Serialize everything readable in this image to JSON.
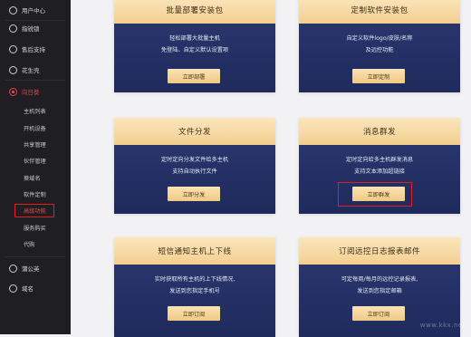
{
  "sidebar": {
    "items": [
      {
        "label": "用户中心"
      },
      {
        "label": "指锐锁"
      },
      {
        "label": "售后支持"
      },
      {
        "label": "花生壳"
      },
      {
        "label": "向日葵"
      }
    ],
    "subitems": [
      {
        "label": "主机列表"
      },
      {
        "label": "开机设备"
      },
      {
        "label": "共享管理"
      },
      {
        "label": "伙伴管理"
      },
      {
        "label": "葵域名"
      },
      {
        "label": "软件定制"
      },
      {
        "label": "高级功能"
      },
      {
        "label": "服务购买"
      },
      {
        "label": "代购"
      }
    ],
    "bottom": [
      {
        "label": "蒲公英"
      },
      {
        "label": "域名"
      }
    ]
  },
  "cards": [
    {
      "title": "批量部署安装包",
      "lines": [
        "轻松部署大批量主机",
        "免登陆、自定义默认设置项"
      ],
      "button": "立即部署"
    },
    {
      "title": "定制软件安装包",
      "lines": [
        "自定义软件logo/皮肤/名称",
        "及远控功能"
      ],
      "button": "立即定制"
    },
    {
      "title": "文件分发",
      "lines": [
        "定时定向分发文件给多主机",
        "支持自动执行文件"
      ],
      "button": "立即分发"
    },
    {
      "title": "消息群发",
      "lines": [
        "定时定向给多主机群发消息",
        "支持文本添加超链接"
      ],
      "button": "立即群发"
    },
    {
      "title": "短信通知主机上下线",
      "lines": [
        "实时获取所有主机的上下线情况,",
        "发送到您指定手机号"
      ],
      "button": "立即订阅"
    },
    {
      "title": "订阅远控日志报表邮件",
      "lines": [
        "可定每周/每月的远控记录报表,",
        "发送到您指定邮箱"
      ],
      "button": "立即订阅"
    }
  ],
  "watermark": "www.kkx.net"
}
